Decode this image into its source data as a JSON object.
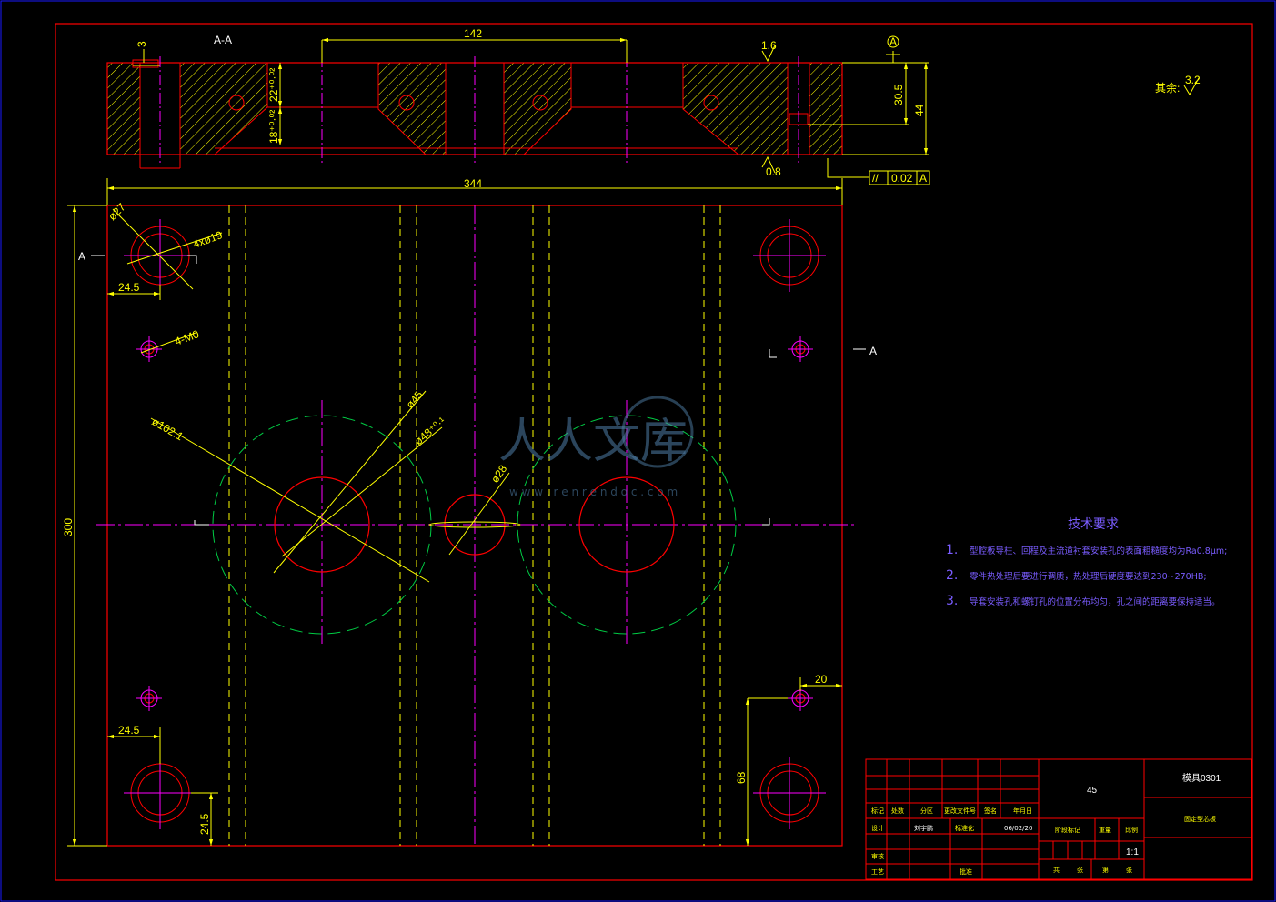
{
  "section": {
    "label": "A-A",
    "cut_marker": "A"
  },
  "dimensions": {
    "top_width": "142",
    "left_depth": "3",
    "depth_a": "22⁺⁰·⁰²",
    "depth_b": "18⁺⁰·⁰²",
    "height_a": "30.5",
    "height_b": "44",
    "overall_width": "344",
    "overall_height": "300",
    "offset_top": "24.5",
    "offset_bottom": "24.5",
    "offset_left_bottom": "24.5",
    "edge_right": "20",
    "right_height": "68"
  },
  "callouts": {
    "d27": "ø27",
    "hole_4x": "4xø19",
    "hole_small": "4-M0",
    "d102": "ø102.1",
    "d45": "ø45",
    "d48": "ø48⁺⁰·¹",
    "d28": "ø28"
  },
  "surface": {
    "roughness_top": "1.6",
    "roughness_bottom": "0.8",
    "roughness_rest": "3.2",
    "rest_label": "其余:",
    "datum": "A"
  },
  "tolerance": {
    "symbol": "//",
    "value": "0.02",
    "datum": "A"
  },
  "requirements": {
    "title": "技术要求",
    "items": [
      {
        "num": "1.",
        "text": "型腔板导柱、回程及主流道衬套安装孔的表面粗糙度均为Ra0.8μm;"
      },
      {
        "num": "2.",
        "text": "零件热处理后要进行调质，热处理后硬度要达到230~270HB;"
      },
      {
        "num": "3.",
        "text": "导套安装孔和螺钉孔的位置分布均匀，孔之间的距离要保持适当。"
      }
    ]
  },
  "title_block": {
    "material": "45",
    "drawing_no": "模具0301",
    "part_name": "固定型芯板",
    "scale": "1:1",
    "date": "06/02/20",
    "headers": [
      "标记",
      "处数",
      "分区",
      "更改文件号",
      "签名",
      "年月日"
    ],
    "rows": [
      {
        "label": "设计",
        "name": "刘宇鹏",
        "std": "标准化"
      },
      {
        "label": "审核",
        "name": "",
        "std": ""
      },
      {
        "label": "工艺",
        "name": "",
        "std": "批准"
      }
    ],
    "stage_label": "阶段标记",
    "weight_label": "重量",
    "ratio_label": "比例",
    "sheet_labels": [
      "共",
      "张",
      "第",
      "张"
    ]
  },
  "watermark": {
    "text": "人人文库",
    "url": "w w w . r e n r e n d o c . c o m"
  },
  "colors": {
    "outline": "#ff0000",
    "dimension": "#ffff00",
    "centerline": "#ff00ff",
    "hidden": "#ffff00",
    "pitch_circle": "#00cc44",
    "annotation": "#ffffff",
    "requirement_text": "#7a5cff"
  }
}
